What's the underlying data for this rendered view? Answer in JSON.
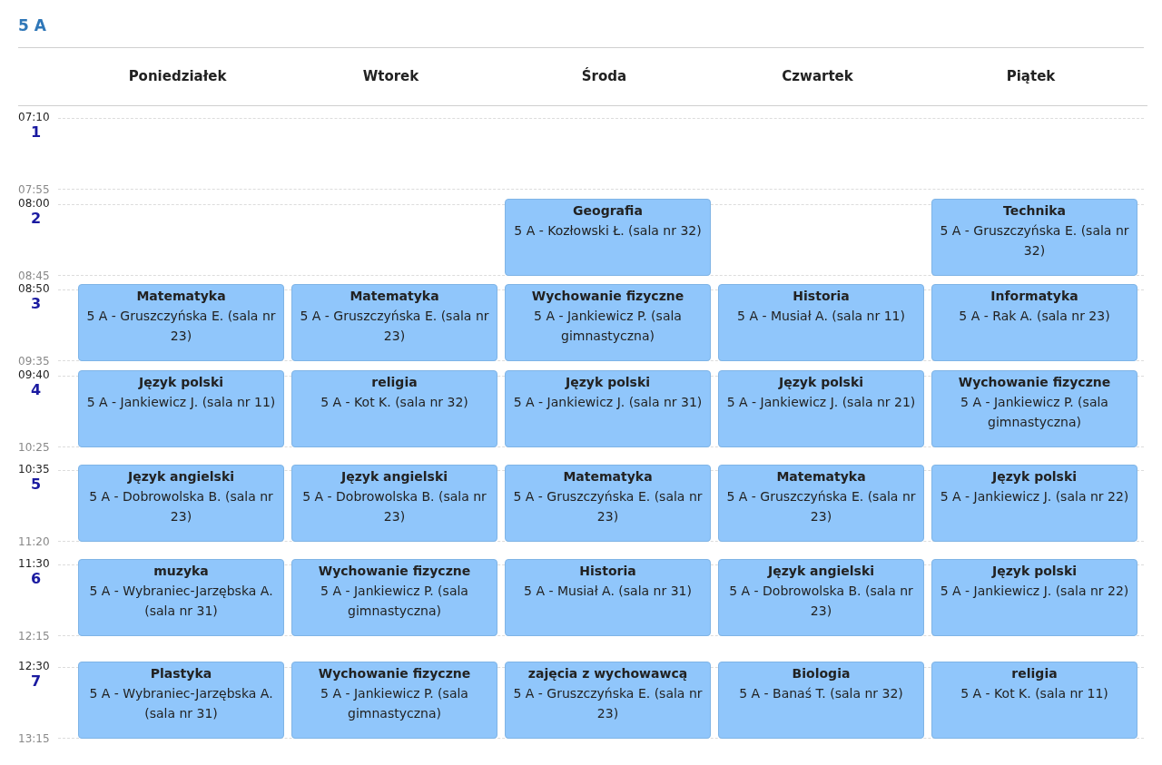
{
  "title": "5 A",
  "days": [
    "Poniedziałek",
    "Wtorek",
    "Środa",
    "Czwartek",
    "Piątek"
  ],
  "periods": [
    {
      "number": "1",
      "start": "07:10",
      "end": "07:55",
      "lessons": [
        {
          "kind": "free"
        },
        {
          "kind": "free"
        },
        {
          "kind": "free"
        },
        {
          "kind": "free"
        },
        {
          "kind": "free"
        }
      ]
    },
    {
      "number": "2",
      "start": "08:00",
      "end": "08:45",
      "lessons": [
        {
          "kind": "free"
        },
        {
          "kind": "free"
        },
        {
          "kind": "lesson",
          "subject": "Geografia",
          "details": "5 A - Kozłowski Ł. (sala nr 32)"
        },
        {
          "kind": "free"
        },
        {
          "kind": "lesson",
          "subject": "Technika",
          "details": "5 A - Gruszczyńska E. (sala nr 32)"
        }
      ]
    },
    {
      "number": "3",
      "start": "08:50",
      "end": "09:35",
      "lessons": [
        {
          "kind": "lesson",
          "subject": "Matematyka",
          "details": "5 A - Gruszczyńska E. (sala nr 23)"
        },
        {
          "kind": "lesson",
          "subject": "Matematyka",
          "details": "5 A - Gruszczyńska E. (sala nr 23)"
        },
        {
          "kind": "lesson",
          "subject": "Wychowanie fizyczne",
          "details": "5 A - Jankiewicz P. (sala gimnastyczna)"
        },
        {
          "kind": "lesson",
          "subject": "Historia",
          "details": "5 A - Musiał A. (sala nr 11)"
        },
        {
          "kind": "lesson",
          "subject": "Informatyka",
          "details": "5 A - Rak A. (sala nr 23)"
        }
      ]
    },
    {
      "number": "4",
      "start": "09:40",
      "end": "10:25",
      "lessons": [
        {
          "kind": "lesson",
          "subject": "Język polski",
          "details": "5 A - Jankiewicz J. (sala nr 11)"
        },
        {
          "kind": "lesson",
          "subject": "religia",
          "details": "5 A - Kot K. (sala nr 32)"
        },
        {
          "kind": "lesson",
          "subject": "Język polski",
          "details": "5 A - Jankiewicz J. (sala nr 31)"
        },
        {
          "kind": "lesson",
          "subject": "Język polski",
          "details": "5 A - Jankiewicz J. (sala nr 21)"
        },
        {
          "kind": "lesson",
          "subject": "Wychowanie fizyczne",
          "details": "5 A - Jankiewicz P. (sala gimnastyczna)"
        }
      ]
    },
    {
      "number": "5",
      "start": "10:35",
      "end": "11:20",
      "lessons": [
        {
          "kind": "lesson",
          "subject": "Język angielski",
          "details": "5 A - Dobrowolska B. (sala nr 23)"
        },
        {
          "kind": "lesson",
          "subject": "Język angielski",
          "details": "5 A - Dobrowolska B. (sala nr 23)"
        },
        {
          "kind": "lesson",
          "subject": "Matematyka",
          "details": "5 A - Gruszczyńska E. (sala nr 23)"
        },
        {
          "kind": "lesson",
          "subject": "Matematyka",
          "details": "5 A - Gruszczyńska E. (sala nr 23)"
        },
        {
          "kind": "lesson",
          "subject": "Język polski",
          "details": "5 A - Jankiewicz J. (sala nr 22)"
        }
      ]
    },
    {
      "number": "6",
      "start": "11:30",
      "end": "12:15",
      "lessons": [
        {
          "kind": "lesson",
          "subject": "muzyka",
          "details": "5 A - Wybraniec-Jarzębska A. (sala nr 31)"
        },
        {
          "kind": "lesson",
          "subject": "Wychowanie fizyczne",
          "details": "5 A - Jankiewicz P. (sala gimnastyczna)"
        },
        {
          "kind": "lesson",
          "subject": "Historia",
          "details": "5 A - Musiał A. (sala nr 31)"
        },
        {
          "kind": "lesson",
          "subject": "Język angielski",
          "details": "5 A - Dobrowolska B. (sala nr 23)"
        },
        {
          "kind": "lesson",
          "subject": "Język polski",
          "details": "5 A - Jankiewicz J. (sala nr 22)"
        }
      ]
    },
    {
      "number": "7",
      "start": "12:30",
      "end": "13:15",
      "lessons": [
        {
          "kind": "lesson",
          "subject": "Plastyka",
          "details": "5 A - Wybraniec-Jarzębska A. (sala nr 31)"
        },
        {
          "kind": "lesson",
          "subject": "Wychowanie fizyczne",
          "details": "5 A - Jankiewicz P. (sala gimnastyczna)"
        },
        {
          "kind": "lesson",
          "subject": "zajęcia z wychowawcą",
          "details": "5 A - Gruszczyńska E. (sala nr 23)"
        },
        {
          "kind": "lesson",
          "subject": "Biologia",
          "details": "5 A - Banaś T. (sala nr 32)"
        },
        {
          "kind": "lesson",
          "subject": "religia",
          "details": "5 A - Kot K. (sala nr 11)"
        }
      ]
    }
  ]
}
